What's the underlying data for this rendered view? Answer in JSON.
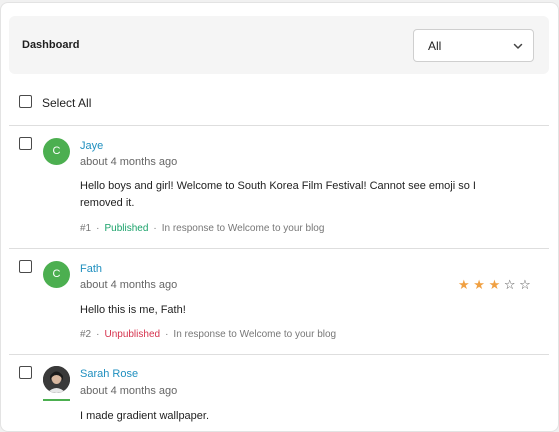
{
  "header": {
    "title": "Dashboard",
    "filter_value": "All"
  },
  "select_all": {
    "label": "Select All"
  },
  "comments": [
    {
      "avatar_letter": "C",
      "author": "Jaye",
      "time": "about 4 months ago",
      "body": "Hello boys and girl! Welcome to South Korea Film Festival! Cannot see emoji so I removed it.",
      "number": "#1",
      "status": "Published",
      "context": "In response to Welcome to your blog"
    },
    {
      "avatar_letter": "C",
      "author": "Fath",
      "time": "about 4 months ago",
      "body": "Hello this is me, Fath!",
      "number": "#2",
      "status": "Unpublished",
      "context": "In response to Welcome to your blog",
      "rating": 3,
      "rating_max": 5
    },
    {
      "author": "Sarah Rose",
      "time": "about 4 months ago",
      "body": "I made gradient wallpaper."
    }
  ],
  "colors": {
    "link": "#1f8fbf",
    "published": "#1aa26a",
    "unpublished": "#d6334e",
    "star": "#f0a042",
    "avatar": "#4caf50"
  },
  "icons": {
    "filter": "chevron-down-icon",
    "star": "star-icon"
  }
}
